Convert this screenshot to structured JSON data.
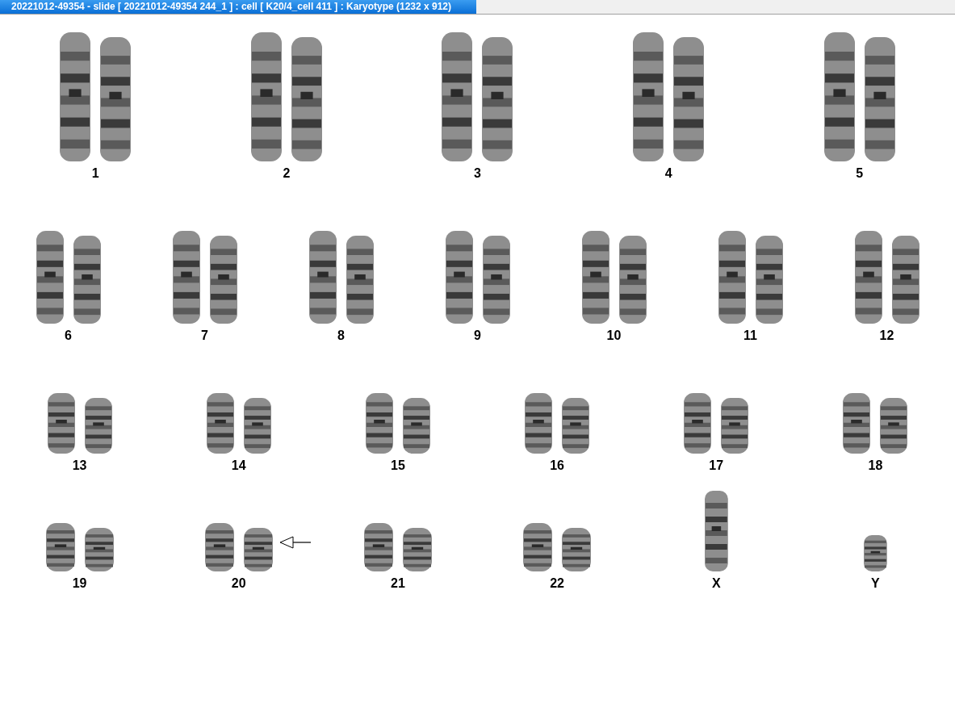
{
  "title_bar": {
    "title": "20221012-49354 - slide [ 20221012-49354 244_1 ] : cell [ K20/4_cell 411 ] : Karyotype  (1232 x 912)"
  },
  "rows": [
    {
      "chromosomes": [
        {
          "label": "1",
          "kind": "pair",
          "marked": false
        },
        {
          "label": "2",
          "kind": "pair",
          "marked": false
        },
        {
          "label": "3",
          "kind": "pair",
          "marked": false
        },
        {
          "label": "4",
          "kind": "pair",
          "marked": false
        },
        {
          "label": "5",
          "kind": "pair",
          "marked": false
        }
      ]
    },
    {
      "chromosomes": [
        {
          "label": "6",
          "kind": "pair",
          "marked": false
        },
        {
          "label": "7",
          "kind": "pair",
          "marked": false
        },
        {
          "label": "8",
          "kind": "pair",
          "marked": false
        },
        {
          "label": "9",
          "kind": "pair",
          "marked": false
        },
        {
          "label": "10",
          "kind": "pair",
          "marked": false
        },
        {
          "label": "11",
          "kind": "pair",
          "marked": false
        },
        {
          "label": "12",
          "kind": "pair",
          "marked": false
        }
      ]
    },
    {
      "chromosomes": [
        {
          "label": "13",
          "kind": "pair",
          "marked": false
        },
        {
          "label": "14",
          "kind": "pair",
          "marked": false
        },
        {
          "label": "15",
          "kind": "pair",
          "marked": false
        },
        {
          "label": "16",
          "kind": "pair",
          "marked": false
        },
        {
          "label": "17",
          "kind": "pair",
          "marked": false
        },
        {
          "label": "18",
          "kind": "pair",
          "marked": false
        }
      ]
    },
    {
      "chromosomes": [
        {
          "label": "19",
          "kind": "pair",
          "marked": false
        },
        {
          "label": "20",
          "kind": "pair",
          "marked": true
        },
        {
          "label": "21",
          "kind": "pair",
          "marked": false
        },
        {
          "label": "22",
          "kind": "pair",
          "marked": false
        },
        {
          "label": "X",
          "kind": "single",
          "marked": false
        },
        {
          "label": "Y",
          "kind": "single",
          "marked": false
        }
      ]
    }
  ]
}
